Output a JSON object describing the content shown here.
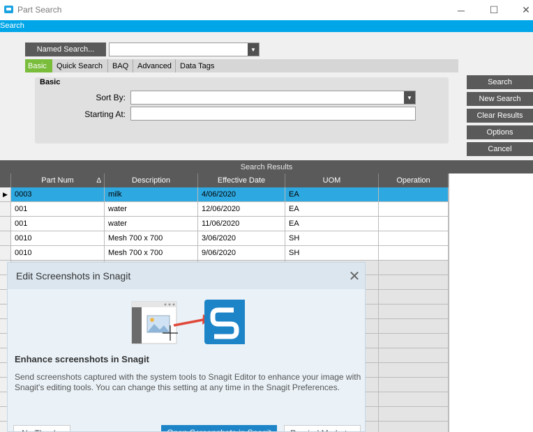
{
  "window": {
    "title": "Part Search",
    "minimize_glyph": "─",
    "maximize_glyph": "☐",
    "close_glyph": "✕",
    "strip_title": "Search"
  },
  "search": {
    "named_search_label": "Named Search...",
    "named_search_value": "",
    "tabs": [
      {
        "label": "Basic",
        "active": true
      },
      {
        "label": "Quick Search"
      },
      {
        "label": "BAQ"
      },
      {
        "label": "Advanced"
      },
      {
        "label": "Data Tags"
      }
    ],
    "basic_heading": "Basic",
    "sort_by_label": "Sort By:",
    "sort_by_value": "",
    "starting_at_label": "Starting At:",
    "starting_at_value": ""
  },
  "buttons": {
    "search": "Search",
    "new_search": "New Search",
    "clear_results": "Clear Results",
    "options": "Options",
    "cancel": "Cancel"
  },
  "results": {
    "header": "Search Results",
    "sort_indicator": "Δ",
    "row_pointer": "▶",
    "columns": [
      "Part Num",
      "Description",
      "Effective Date",
      "UOM",
      "Operation"
    ],
    "rows": [
      [
        "0003",
        "milk",
        "4/06/2020",
        "EA",
        ""
      ],
      [
        "001",
        "water",
        "12/06/2020",
        "EA",
        ""
      ],
      [
        "001",
        "water",
        "11/06/2020",
        "EA",
        ""
      ],
      [
        "0010",
        "Mesh 700 x 700",
        "3/06/2020",
        "SH",
        ""
      ],
      [
        "0010",
        "Mesh 700 x 700",
        "9/06/2020",
        "SH",
        ""
      ]
    ]
  },
  "snagit": {
    "title": "Edit Screenshots in Snagit",
    "heading": "Enhance screenshots in Snagit",
    "body": "Send screenshots captured with the system tools to Snagit Editor to enhance your image with Snagit's editing tools. You can change this setting at any time in the Snagit Preferences.",
    "no_thanks": "No Thanks",
    "open_button": "Open Screenshots in Snagit",
    "remind": "Remind Me Later"
  },
  "colors": {
    "accent_blue": "#00a6e8",
    "active_tab_green": "#79bd3a",
    "selected_row": "#2ea8e0",
    "dark_button": "#5a5a5a",
    "snagit_blue": "#1e84c8"
  }
}
